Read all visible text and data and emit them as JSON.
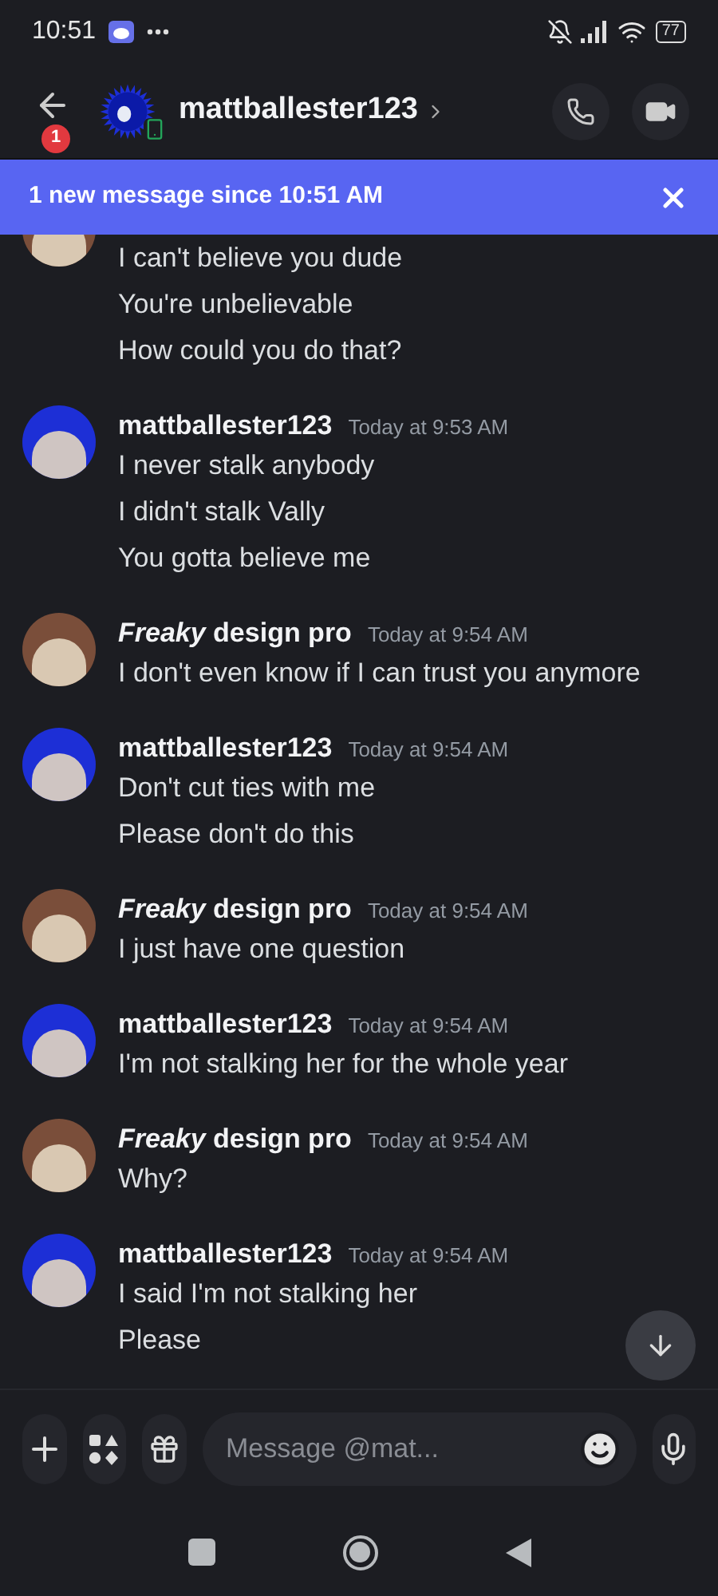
{
  "status_bar": {
    "time": "10:51",
    "battery": "77"
  },
  "header": {
    "back_badge": "1",
    "username": "mattballester123"
  },
  "banner": {
    "text": "1 new message since 10:51 AM"
  },
  "messages": [
    {
      "kind": "continuation",
      "color": "#7a4e3a",
      "lines": [
        "I can't believe you dude",
        "You're unbelievable",
        "How could you do that?"
      ]
    },
    {
      "kind": "group",
      "color": "#1d2fd6",
      "author": "mattballester123",
      "time": "Today at 9:53 AM",
      "lines": [
        "I never stalk anybody",
        "I didn't stalk Vally",
        "You gotta believe me"
      ]
    },
    {
      "kind": "group",
      "color": "#7a4e3a",
      "author": "*Freaky* design pro",
      "time": "Today at 9:54 AM",
      "lines": [
        "I don't even know if I can trust you anymore"
      ]
    },
    {
      "kind": "group",
      "color": "#1d2fd6",
      "author": "mattballester123",
      "time": "Today at 9:54 AM",
      "lines": [
        "Don't cut ties with me",
        "Please don't do this"
      ]
    },
    {
      "kind": "group",
      "color": "#7a4e3a",
      "author": "*Freaky* design pro",
      "time": "Today at 9:54 AM",
      "lines": [
        "I just have one question"
      ]
    },
    {
      "kind": "group",
      "color": "#1d2fd6",
      "author": "mattballester123",
      "time": "Today at 9:54 AM",
      "lines": [
        "I'm not stalking her for the whole year"
      ]
    },
    {
      "kind": "group",
      "color": "#7a4e3a",
      "author": "*Freaky* design pro",
      "time": "Today at 9:54 AM",
      "lines": [
        "Why?"
      ]
    },
    {
      "kind": "group",
      "color": "#1d2fd6",
      "author": "mattballester123",
      "time": "Today at 9:54 AM",
      "lines": [
        "I said I'm not stalking her",
        "Please"
      ]
    }
  ],
  "composer": {
    "placeholder": "Message @mat..."
  }
}
